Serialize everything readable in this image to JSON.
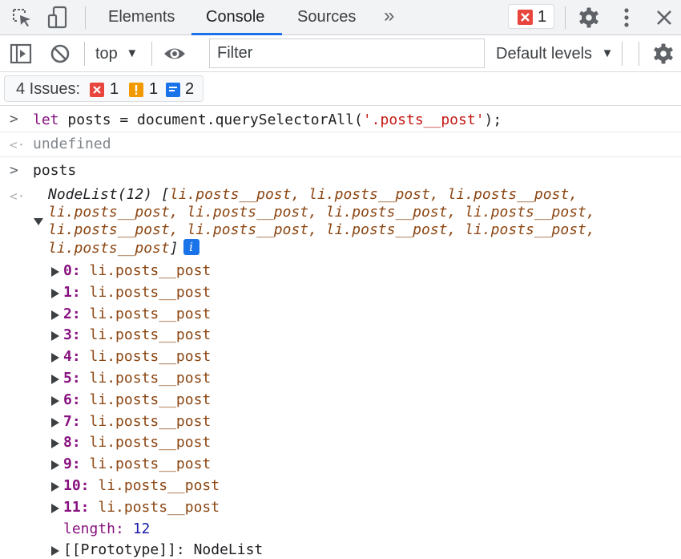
{
  "tabs": {
    "items": [
      {
        "label": "Elements"
      },
      {
        "label": "Console"
      },
      {
        "label": "Sources"
      }
    ],
    "more_label": "»",
    "error_count": "1",
    "icons": [
      "inspect-icon",
      "device-toolbar-icon",
      "settings-icon",
      "kebab-menu-icon",
      "close-icon"
    ]
  },
  "toolbar": {
    "context": "top",
    "filter_placeholder": "Filter",
    "levels": "Default levels",
    "icons": [
      "sidebar-toggle-icon",
      "clear-console-icon",
      "live-expression-eye-icon",
      "console-settings-icon"
    ]
  },
  "issues": {
    "label": "4 Issues:",
    "error_count": "1",
    "warning_count": "1",
    "info_count": "2",
    "colors": {
      "error": "#e8453c",
      "warning": "#f29900",
      "info": "#1a73e8"
    }
  },
  "console": {
    "cmd1": {
      "keyword": "let",
      "code_before": " posts = document.querySelectorAll(",
      "string": "'.posts__post'",
      "code_after": ");"
    },
    "result1": "undefined",
    "cmd2": "posts",
    "nodelist": {
      "summary_type": "NodeList(12)",
      "summary_lines": [
        "li.posts__post, li.posts__post, li.posts__post,",
        "li.posts__post, li.posts__post, li.posts__post, li.posts__post,",
        "li.posts__post, li.posts__post, li.posts__post, li.posts__post,",
        "li.posts__post"
      ],
      "entries": [
        {
          "index": "0:",
          "value": "li.posts__post"
        },
        {
          "index": "1:",
          "value": "li.posts__post"
        },
        {
          "index": "2:",
          "value": "li.posts__post"
        },
        {
          "index": "3:",
          "value": "li.posts__post"
        },
        {
          "index": "4:",
          "value": "li.posts__post"
        },
        {
          "index": "5:",
          "value": "li.posts__post"
        },
        {
          "index": "6:",
          "value": "li.posts__post"
        },
        {
          "index": "7:",
          "value": "li.posts__post"
        },
        {
          "index": "8:",
          "value": "li.posts__post"
        },
        {
          "index": "9:",
          "value": "li.posts__post"
        },
        {
          "index": "10:",
          "value": "li.posts__post"
        },
        {
          "index": "11:",
          "value": "li.posts__post"
        }
      ],
      "length_key": "length:",
      "length_value": "12",
      "prototype_key": "[[Prototype]]:",
      "prototype_value": "NodeList"
    }
  }
}
